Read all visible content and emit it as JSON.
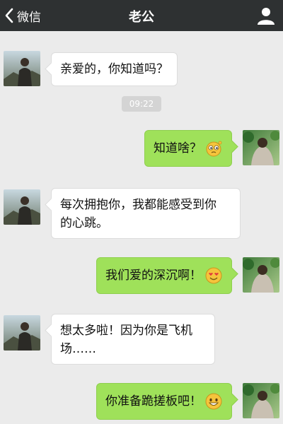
{
  "header": {
    "back_label": "微信",
    "title": "老公"
  },
  "timestamp": "09:22",
  "messages": [
    {
      "side": "in",
      "text": "亲爱的，你知道吗？",
      "emoji": ""
    },
    {
      "side": "out",
      "text": "知道啥？",
      "emoji": "thinking-face-icon"
    },
    {
      "side": "in",
      "text": "每次拥抱你，我都能感受到你的心跳。",
      "lines": [
        "每次拥抱你，我都能感受到你",
        "的心跳。"
      ],
      "emoji": ""
    },
    {
      "side": "out",
      "text": "我们爱的深沉啊！",
      "emoji": "heart-eyes-face-icon"
    },
    {
      "side": "in",
      "text": "想太多啦！因为你是飞机场……",
      "lines": [
        "想太多啦！因为你是飞机",
        "场……"
      ],
      "emoji": ""
    },
    {
      "side": "out",
      "text": "你准备跪搓板吧！",
      "emoji": "grinning-face-icon"
    }
  ],
  "colors": {
    "topbar": "#2e3132",
    "background": "#ebebeb",
    "outgoing_bubble": "#9fe15a",
    "incoming_bubble": "#ffffff"
  }
}
